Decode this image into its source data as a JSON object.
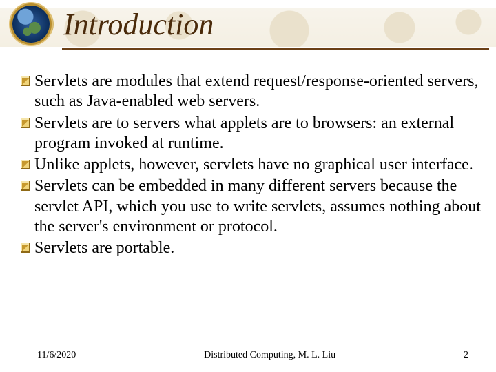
{
  "title": "Introduction",
  "bullets": [
    "Servlets are modules that extend request/response-oriented servers, such as Java-enabled web servers.",
    "Servlets are to servers what applets are to browsers: an external program invoked at runtime.",
    "Unlike applets, however, servlets have no graphical user interface.",
    "Servlets can be embedded in many different servers because the servlet API, which you use to write servlets, assumes nothing about the server's environment or protocol.",
    "Servlets are portable."
  ],
  "footer": {
    "date": "11/6/2020",
    "center": "Distributed Computing, M. L. Liu",
    "page": "2"
  }
}
